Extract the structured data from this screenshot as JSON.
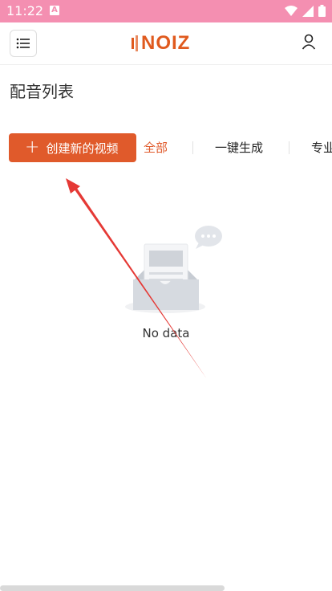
{
  "status_bar": {
    "time": "11:22",
    "a_icon_label": "A"
  },
  "header": {
    "logo_text": "NOIZ",
    "menu_icon": "list-icon",
    "user_icon": "person-icon"
  },
  "page": {
    "title": "配音列表"
  },
  "actions": {
    "create_label": "创建新的视频"
  },
  "tabs": [
    {
      "label": "全部",
      "active": true
    },
    {
      "label": "一键生成",
      "active": false
    },
    {
      "label": "专业",
      "active": false
    }
  ],
  "empty_state": {
    "text": "No data"
  },
  "colors": {
    "accent": "#e05a2b",
    "status_bar": "#f48fb1",
    "annotation_arrow": "#e53935"
  }
}
